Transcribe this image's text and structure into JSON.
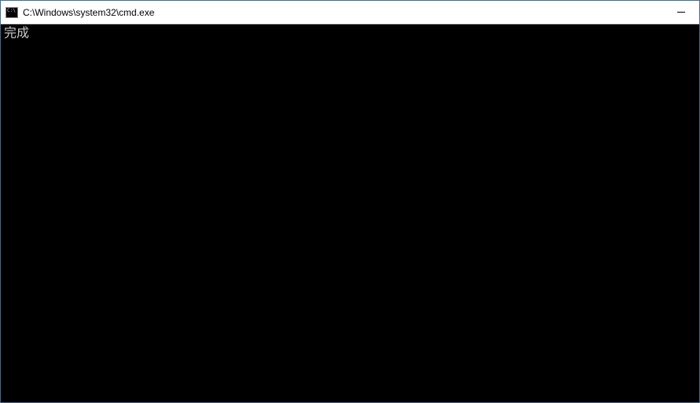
{
  "window": {
    "title": "C:\\Windows\\system32\\cmd.exe"
  },
  "terminal": {
    "lines": [
      "完成"
    ]
  }
}
